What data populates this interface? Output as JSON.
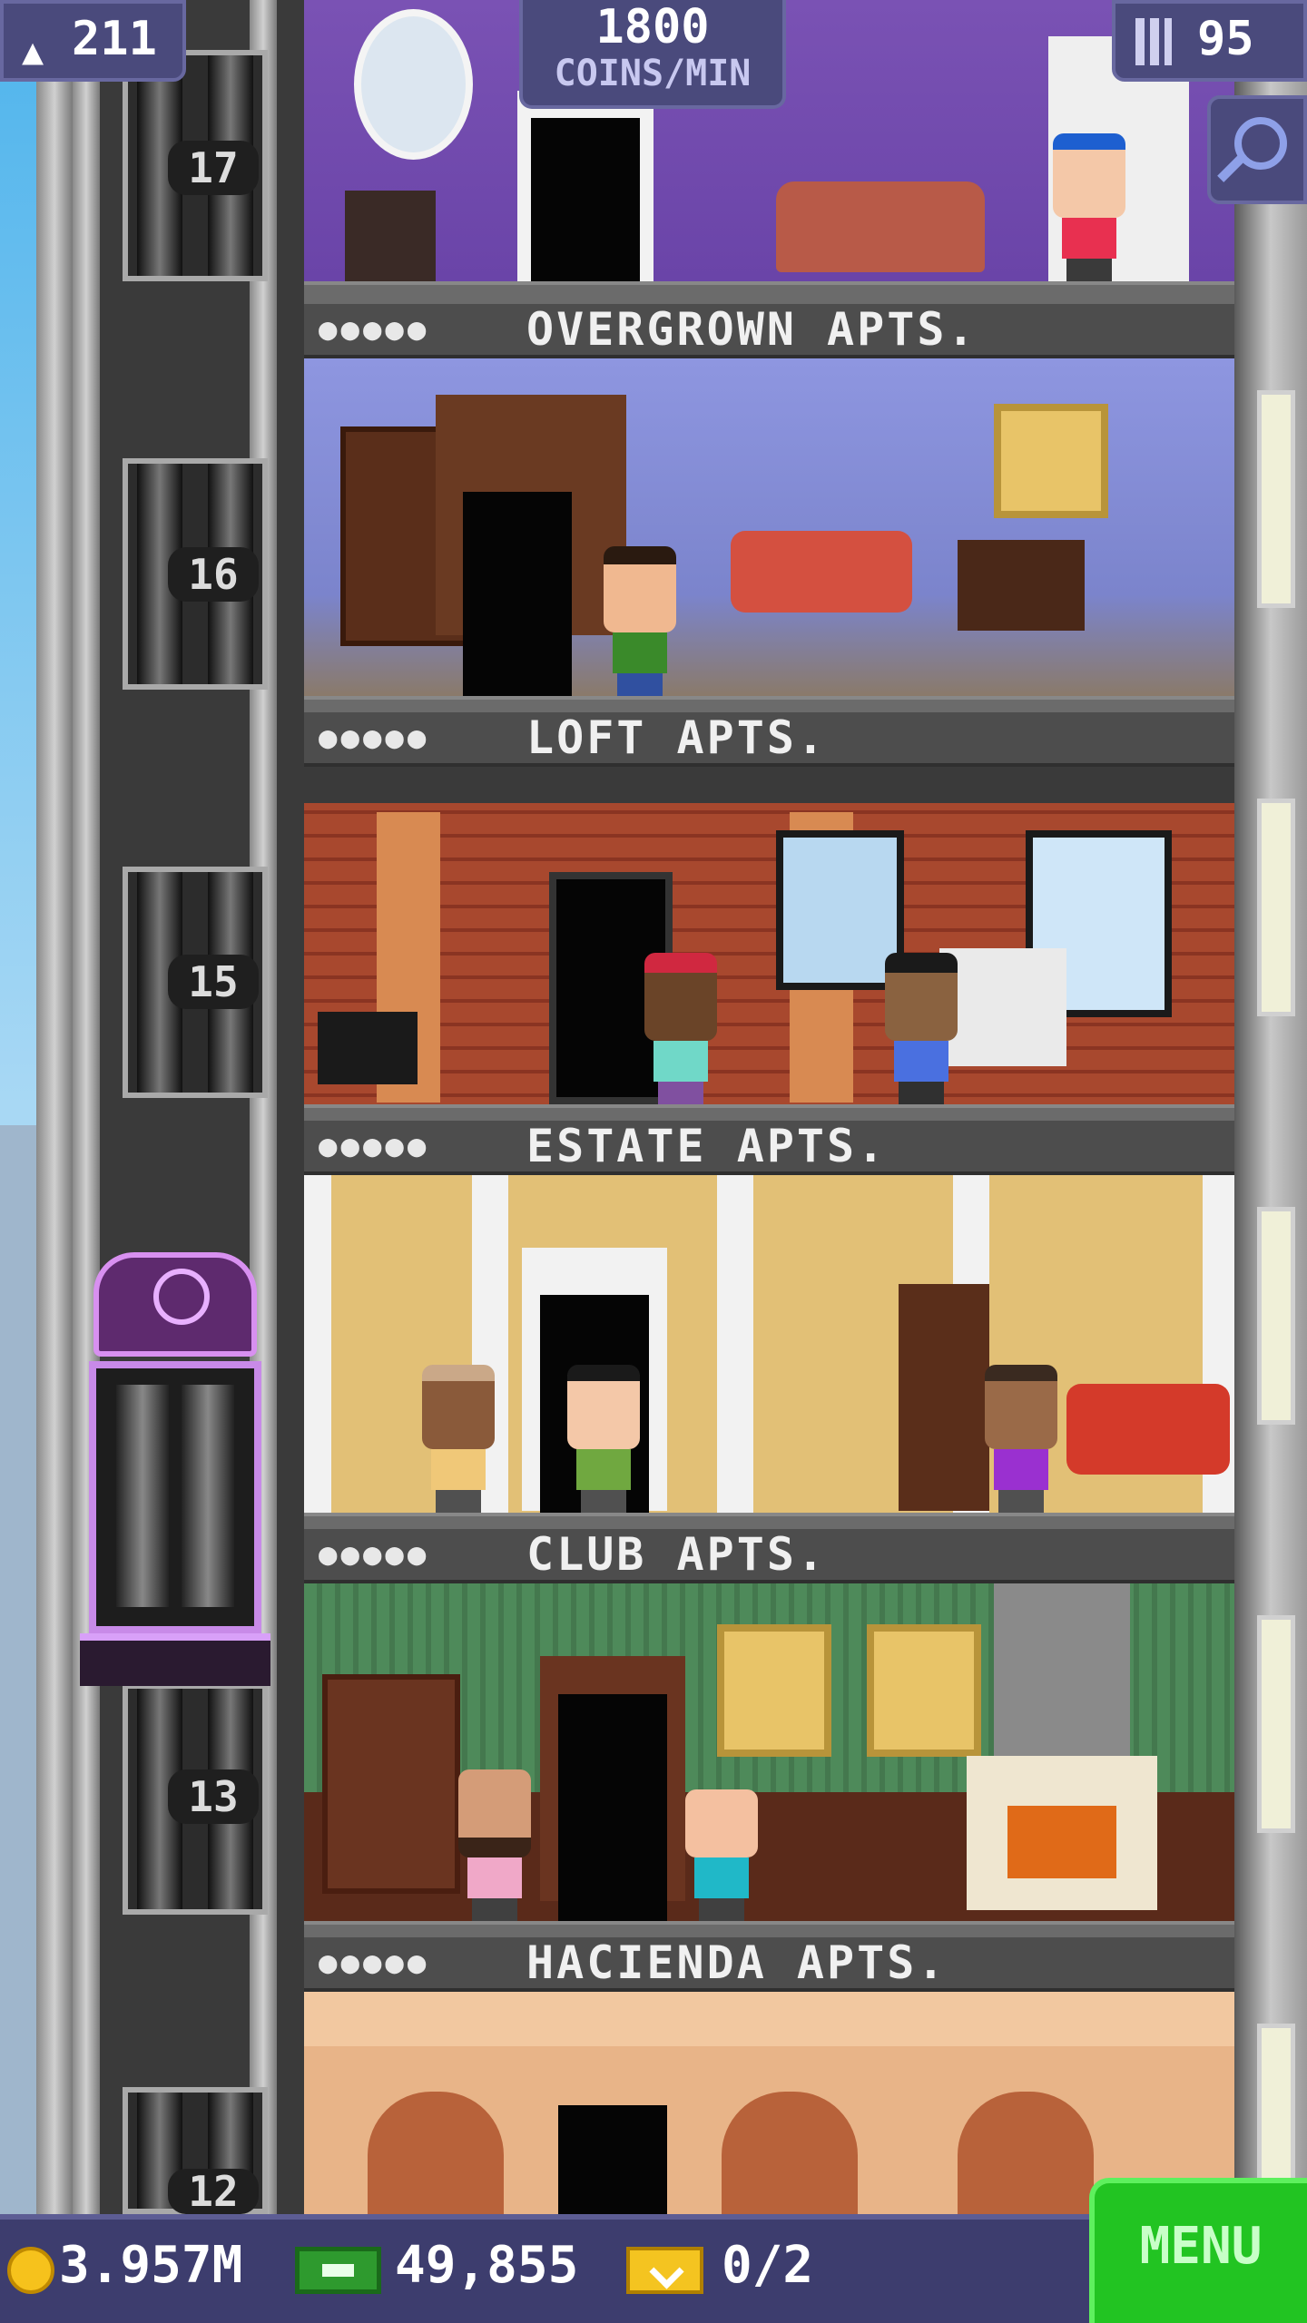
{
  "hud": {
    "population": "211",
    "coins_per_min_value": "1800",
    "coins_per_min_label": "COINS/MIN",
    "floors_count": "95"
  },
  "elevator": {
    "floor_numbers": [
      "17",
      "16",
      "15",
      "13",
      "12"
    ]
  },
  "floors": [
    {
      "name": "OVERGROWN APTS.",
      "residents": "●●●●●"
    },
    {
      "name": "LOFT APTS.",
      "residents": "●●●●●"
    },
    {
      "name": "ESTATE APTS.",
      "residents": "●●●●●"
    },
    {
      "name": "CLUB APTS.",
      "residents": "●●●●●"
    },
    {
      "name": "HACIENDA APTS.",
      "residents": "●●●●●"
    }
  ],
  "bottom_bar": {
    "coins": "3.957M",
    "bux": "49,855",
    "tickets": "0/2",
    "menu_label": "MENU"
  },
  "colors": {
    "hud_bg": "#4a4a7c",
    "menu_green": "#22c422",
    "coin_gold": "#f6c21c"
  },
  "icons": [
    "population-icon",
    "floors-icon",
    "search-icon",
    "coin-icon",
    "bux-icon",
    "ticket-icon"
  ]
}
